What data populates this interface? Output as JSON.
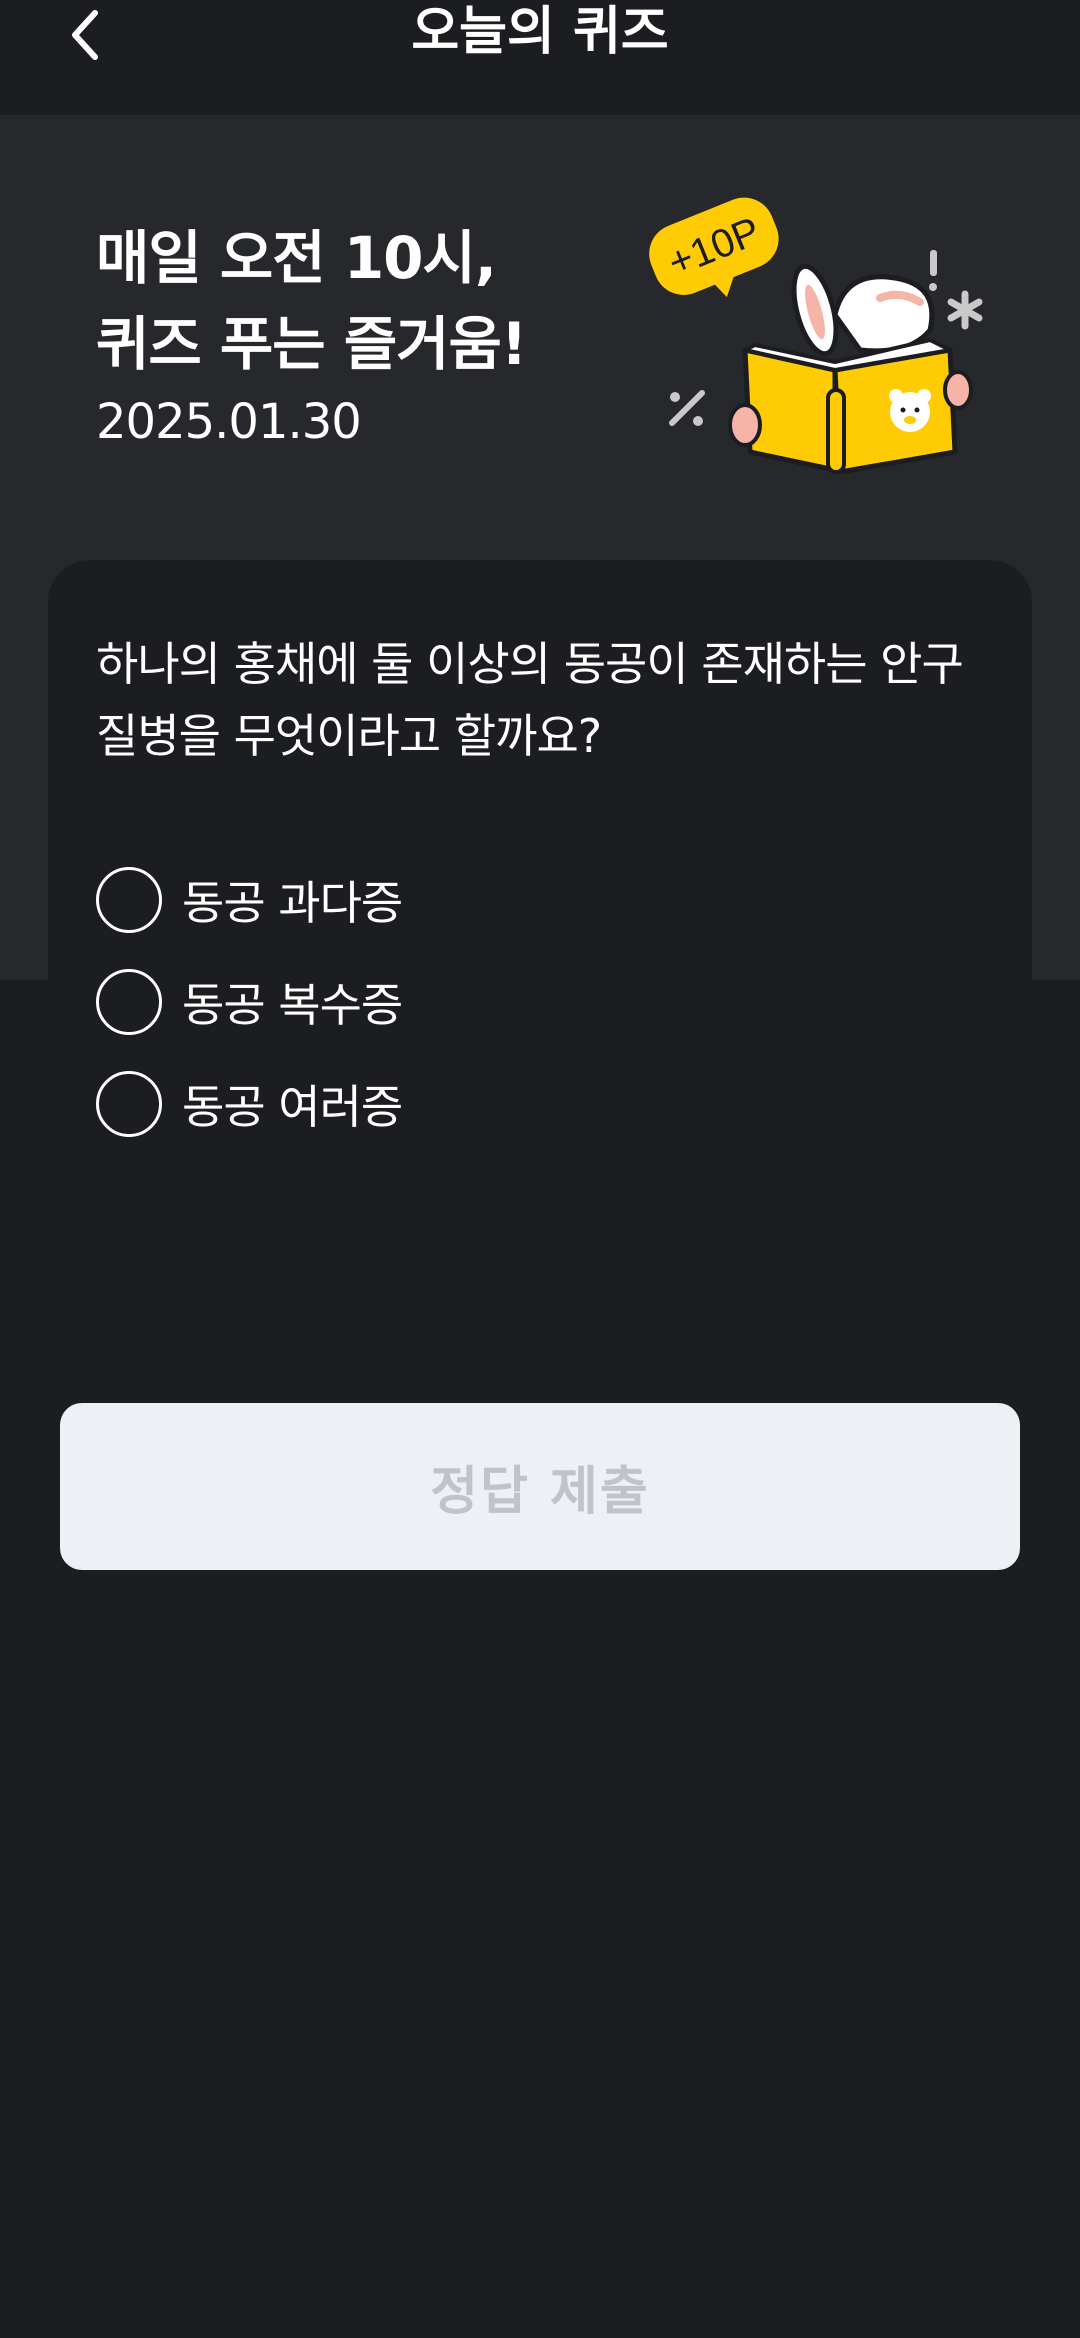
{
  "header": {
    "title": "오늘의 퀴즈",
    "back_icon": "chevron-left-icon"
  },
  "hero": {
    "headline_line1": "매일 오전 10시,",
    "headline_line2": "퀴즈 푸는 즐거움!",
    "date": "2025.01.30",
    "badge_text": "+10P",
    "illustration_icon": "rabbit-reading-book-icon",
    "accent_color": "#ffcb05"
  },
  "quiz": {
    "question": "하나의 홍채에 둘 이상의 동공이 존재하는 안구 질병을 무엇이라고 할까요?",
    "options": [
      {
        "label": "동공 과다증"
      },
      {
        "label": "동공 복수증"
      },
      {
        "label": "동공 여러증"
      }
    ]
  },
  "footer": {
    "submit_label": "정답 제출"
  }
}
